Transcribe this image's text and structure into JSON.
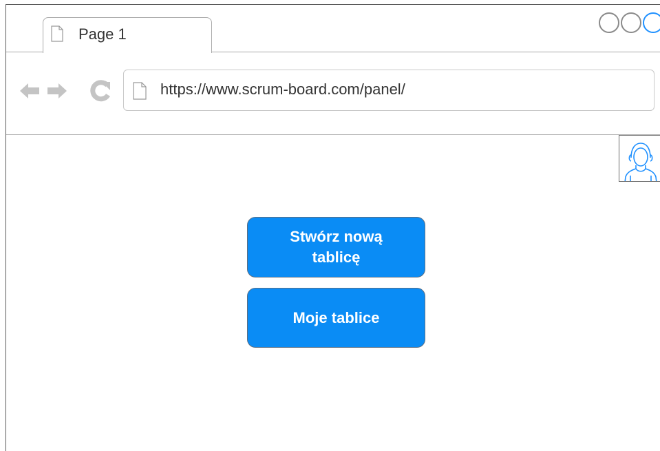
{
  "tab": {
    "title": "Page 1",
    "icon": "page-icon"
  },
  "window_controls": {
    "icons": [
      "circle-icon",
      "circle-icon",
      "circle-icon"
    ],
    "active_color": "#1e90ff"
  },
  "nav": {
    "back_icon": "arrow-left-icon",
    "forward_icon": "arrow-right-icon",
    "reload_icon": "reload-icon"
  },
  "address_bar": {
    "url": "https://www.scrum-board.com/panel/",
    "icon": "page-icon"
  },
  "user": {
    "avatar_icon": "user-avatar-icon"
  },
  "actions": {
    "create_board_label": "Stwórz nową tablicę",
    "my_boards_label": "Moje tablice",
    "button_color": "#0a8cf5"
  }
}
